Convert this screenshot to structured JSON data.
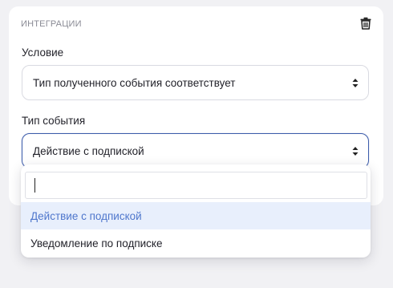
{
  "section": {
    "title": "ИНТЕГРАЦИИ",
    "delete_icon": "trash-icon"
  },
  "condition": {
    "label": "Условие",
    "selected": "Тип полученного события соответствует"
  },
  "event_type": {
    "label": "Тип события",
    "selected": "Действие с подпиской",
    "search_value": "",
    "options": [
      "Действие с подпиской",
      "Уведомление по подписке"
    ]
  },
  "colors": {
    "accent": "#3d5dab",
    "highlight_bg": "#e8effc",
    "highlight_text": "#4e76cc"
  }
}
